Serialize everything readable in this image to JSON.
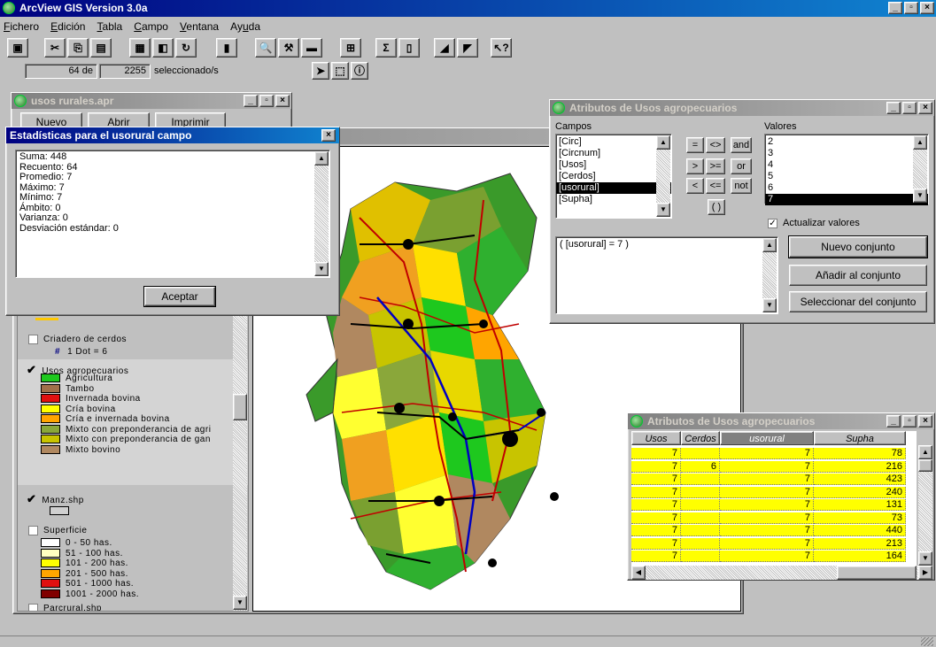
{
  "app": {
    "title": "ArcView GIS Version 3.0a",
    "menu": [
      "Fichero",
      "Edición",
      "Tabla",
      "Campo",
      "Ventana",
      "Ayuda"
    ],
    "menu_underline": [
      "F",
      "E",
      "T",
      "C",
      "V",
      "u"
    ],
    "status": {
      "selected": "64",
      "de": "de",
      "total": "2255",
      "suffix": "seleccionado/s"
    },
    "window_buttons": [
      "_",
      "▫",
      "×"
    ]
  },
  "toolbar": {
    "icons": [
      "save-icon",
      "cut-icon",
      "copy-icon",
      "paste-icon",
      "table-icon",
      "layout-icon",
      "refresh-icon",
      "chart-icon",
      "find-icon",
      "query-icon",
      "select-all-icon",
      "promote-icon",
      "sum-icon",
      "stats-icon",
      "sort-asc-icon",
      "sort-desc-icon",
      "help-icon"
    ],
    "tool_icons": [
      "pointer-icon",
      "select-feature-icon",
      "identify-icon"
    ]
  },
  "project": {
    "title": "usos rurales.apr",
    "buttons": [
      "Nuevo",
      "Abrir",
      "Imprimir"
    ]
  },
  "stats": {
    "title": "Estadísticas para el usorural campo",
    "lines": [
      "Suma: 448",
      "Recuento: 64",
      "Promedio: 7",
      "Máximo: 7",
      "Mínimo: 7",
      "Ámbito: 0",
      "Varianza: 0",
      "Desviación estándar: 0"
    ],
    "ok": "Aceptar"
  },
  "legend": {
    "cerdos": {
      "name": "Criadero de cerdos",
      "dot": "#",
      "dot_label": "1 Dot = 6"
    },
    "usos": {
      "name": "Usos agropecuarios",
      "items": [
        {
          "label": "Agricultura",
          "color": "#1ec81e"
        },
        {
          "label": "Tambo",
          "color": "#a0704a"
        },
        {
          "label": "Invernada bovina",
          "color": "#e01010"
        },
        {
          "label": "Cría bovina",
          "color": "#ffff00"
        },
        {
          "label": "Cría e invernada bovina",
          "color": "#ffa500"
        },
        {
          "label": "Mixto con preponderancia de agri",
          "color": "#8aa73a"
        },
        {
          "label": "Mixto con preponderancia de gan",
          "color": "#c8c400"
        },
        {
          "label": "Mixto bovino",
          "color": "#b08860"
        }
      ]
    },
    "manz": {
      "name": "Manz.shp"
    },
    "superficie": {
      "name": "Superficie",
      "items": [
        {
          "label": "0 - 50 has.",
          "color": "#ffffff"
        },
        {
          "label": "51 - 100 has.",
          "color": "#ffffc0"
        },
        {
          "label": "101 - 200 has.",
          "color": "#ffff00"
        },
        {
          "label": "201 - 500 has.",
          "color": "#ffa500"
        },
        {
          "label": "501 - 1000 has.",
          "color": "#e01010"
        },
        {
          "label": "1001 - 2000 has.",
          "color": "#800000"
        }
      ]
    },
    "parcrural": {
      "name": "Parcrural.shp"
    }
  },
  "query": {
    "title": "Atributos de Usos agropecuarios",
    "campos_label": "Campos",
    "valores_label": "Valores",
    "campos": [
      "[Circ]",
      "[Circnum]",
      "[Usos]",
      "[Cerdos]",
      "[usorural]",
      "[Supha]"
    ],
    "campos_selected": 4,
    "valores": [
      "2",
      "3",
      "4",
      "5",
      "6",
      "7"
    ],
    "valores_selected": 5,
    "operators": [
      "=",
      "<>",
      "and",
      ">",
      ">=",
      "or",
      "<",
      "<=",
      "not",
      "( )"
    ],
    "update_label": "Actualizar valores",
    "expression": "( [usorural] = 7 )",
    "buttons": [
      "Nuevo conjunto",
      "Añadir al conjunto",
      "Seleccionar del conjunto"
    ]
  },
  "table": {
    "title": "Atributos de Usos agropecuarios",
    "headers": [
      "Usos",
      "Cerdos",
      "usorural",
      "Supha"
    ],
    "rows": [
      [
        "7",
        "",
        "7",
        "78"
      ],
      [
        "7",
        "6",
        "7",
        "216"
      ],
      [
        "7",
        "",
        "7",
        "423"
      ],
      [
        "7",
        "",
        "7",
        "240"
      ],
      [
        "7",
        "",
        "7",
        "131"
      ],
      [
        "7",
        "",
        "7",
        "73"
      ],
      [
        "7",
        "",
        "7",
        "440"
      ],
      [
        "7",
        "",
        "7",
        "213"
      ],
      [
        "7",
        "",
        "7",
        "164"
      ]
    ]
  }
}
